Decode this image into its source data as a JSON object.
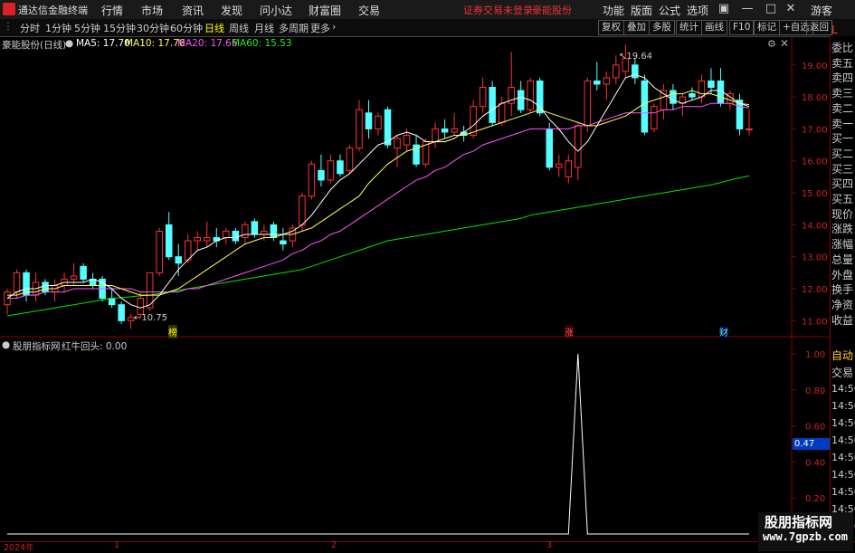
{
  "titlebar": {
    "app_title": "通达信金融终端",
    "menus": [
      "行情",
      "市场",
      "资讯",
      "发现",
      "问小达",
      "财富圈",
      "交易"
    ],
    "notice": "证券交易未登录",
    "stock_name": "豪能股份",
    "right_menus": [
      "功能",
      "版面",
      "公式",
      "选项"
    ],
    "guest": "游客"
  },
  "toolbar": {
    "periods": [
      "分时",
      "1分钟",
      "5分钟",
      "15分钟",
      "30分钟",
      "60分钟",
      "日线",
      "周线",
      "月线",
      "多周期",
      "更多"
    ],
    "active_period": "日线",
    "more_arrow": "›",
    "buttons": [
      "复权",
      "叠加",
      "多股",
      "统计",
      "画线",
      "F10",
      "标记",
      "+自选",
      "返回"
    ]
  },
  "main_chart": {
    "title": "豪能股份(日线)",
    "ma5_label": "MA5: 17.70",
    "ma10_label": "MA10: 17.76",
    "ma20_label": "MA20: 17.66",
    "ma60_label": "MA60: 15.53",
    "high_label": "19.64",
    "low_label": "10.75",
    "markers": [
      "榜",
      "涨",
      "财"
    ],
    "y_ticks": [
      "19.00",
      "18.00",
      "17.00",
      "16.00",
      "15.00",
      "14.00",
      "13.00",
      "12.00",
      "11.00"
    ]
  },
  "indicator": {
    "title": "股朋指标网",
    "series_label": "红牛回头: 0.00",
    "y_ticks": [
      "1.00",
      "0.80",
      "0.60",
      "0.40",
      "0.20"
    ],
    "cursor_value": "0.47"
  },
  "right_panel": {
    "labels": [
      "L",
      "委比",
      "卖五",
      "卖四",
      "卖三",
      "卖二",
      "卖一",
      "买一",
      "买二",
      "买三",
      "买四",
      "买五",
      "现价",
      "涨跌",
      "涨幅",
      "总量",
      "外盘",
      "换手",
      "净资",
      "收益"
    ],
    "trade_labels": [
      "自动",
      "交易"
    ],
    "times": [
      "14:56",
      "14:56",
      "14:56",
      "14:56",
      "14:56",
      "14:56",
      "14:56",
      "14:56",
      "14:56"
    ]
  },
  "x_axis": {
    "labels": [
      "2024年",
      "1",
      "2",
      "3"
    ]
  },
  "watermark": {
    "line1": "股朋指标网",
    "line2": "www.7gpzb.com"
  },
  "colors": {
    "up": "#ff3232",
    "down": "#54ffff",
    "ma5": "#ffffff",
    "ma10": "#ffff54",
    "ma20": "#ff54ff",
    "ma60": "#00e600",
    "frame": "#800000"
  },
  "chart_data": {
    "type": "candlestick",
    "ylim": [
      10.5,
      19.9
    ],
    "candles": [
      {
        "o": 11.5,
        "h": 12.0,
        "l": 11.2,
        "c": 11.9
      },
      {
        "o": 11.9,
        "h": 12.6,
        "l": 11.7,
        "c": 12.5
      },
      {
        "o": 12.5,
        "h": 12.6,
        "l": 11.6,
        "c": 11.8
      },
      {
        "o": 11.8,
        "h": 12.5,
        "l": 11.6,
        "c": 12.2
      },
      {
        "o": 12.2,
        "h": 12.3,
        "l": 11.8,
        "c": 11.9
      },
      {
        "o": 11.9,
        "h": 12.3,
        "l": 11.6,
        "c": 12.1
      },
      {
        "o": 12.1,
        "h": 12.5,
        "l": 11.9,
        "c": 12.3
      },
      {
        "o": 12.3,
        "h": 12.8,
        "l": 12.1,
        "c": 12.4
      },
      {
        "o": 12.7,
        "h": 12.8,
        "l": 12.2,
        "c": 12.3
      },
      {
        "o": 12.3,
        "h": 12.5,
        "l": 12.0,
        "c": 12.1
      },
      {
        "o": 12.3,
        "h": 12.4,
        "l": 11.6,
        "c": 11.7
      },
      {
        "o": 11.7,
        "h": 12.0,
        "l": 11.4,
        "c": 11.5
      },
      {
        "o": 11.5,
        "h": 11.6,
        "l": 10.9,
        "c": 11.0
      },
      {
        "o": 11.0,
        "h": 11.2,
        "l": 10.75,
        "c": 11.1
      },
      {
        "o": 11.2,
        "h": 11.9,
        "l": 11.1,
        "c": 11.7
      },
      {
        "o": 11.4,
        "h": 12.3,
        "l": 11.3,
        "c": 12.5
      },
      {
        "o": 12.5,
        "h": 13.9,
        "l": 12.4,
        "c": 13.8
      },
      {
        "o": 14.0,
        "h": 14.4,
        "l": 12.9,
        "c": 13.0
      },
      {
        "o": 13.0,
        "h": 13.4,
        "l": 12.4,
        "c": 12.8
      },
      {
        "o": 12.9,
        "h": 13.7,
        "l": 12.8,
        "c": 13.5
      },
      {
        "o": 13.5,
        "h": 13.8,
        "l": 13.2,
        "c": 13.6
      },
      {
        "o": 13.5,
        "h": 14.1,
        "l": 13.3,
        "c": 13.6
      },
      {
        "o": 13.6,
        "h": 13.9,
        "l": 13.3,
        "c": 13.5
      },
      {
        "o": 13.6,
        "h": 13.9,
        "l": 13.4,
        "c": 13.8
      },
      {
        "o": 13.8,
        "h": 13.9,
        "l": 13.4,
        "c": 13.5
      },
      {
        "o": 13.6,
        "h": 14.1,
        "l": 13.4,
        "c": 14.0
      },
      {
        "o": 14.1,
        "h": 14.2,
        "l": 13.6,
        "c": 13.7
      },
      {
        "o": 13.7,
        "h": 14.0,
        "l": 13.5,
        "c": 13.8
      },
      {
        "o": 14.0,
        "h": 14.1,
        "l": 13.5,
        "c": 13.6
      },
      {
        "o": 13.5,
        "h": 13.9,
        "l": 13.2,
        "c": 13.4
      },
      {
        "o": 13.5,
        "h": 14.0,
        "l": 13.3,
        "c": 13.9
      },
      {
        "o": 14.0,
        "h": 15.0,
        "l": 13.8,
        "c": 14.9
      },
      {
        "o": 14.9,
        "h": 16.0,
        "l": 14.8,
        "c": 15.9
      },
      {
        "o": 15.7,
        "h": 16.2,
        "l": 15.2,
        "c": 15.4
      },
      {
        "o": 15.4,
        "h": 16.2,
        "l": 15.3,
        "c": 16.0
      },
      {
        "o": 16.0,
        "h": 16.2,
        "l": 15.5,
        "c": 15.6
      },
      {
        "o": 15.7,
        "h": 16.5,
        "l": 15.6,
        "c": 16.4
      },
      {
        "o": 16.4,
        "h": 17.9,
        "l": 16.3,
        "c": 17.6
      },
      {
        "o": 17.5,
        "h": 17.9,
        "l": 16.7,
        "c": 17.0
      },
      {
        "o": 17.0,
        "h": 17.5,
        "l": 16.8,
        "c": 17.4
      },
      {
        "o": 17.6,
        "h": 17.7,
        "l": 16.4,
        "c": 16.5
      },
      {
        "o": 16.4,
        "h": 16.8,
        "l": 15.8,
        "c": 16.7
      },
      {
        "o": 16.5,
        "h": 17.0,
        "l": 16.3,
        "c": 16.8
      },
      {
        "o": 16.5,
        "h": 16.8,
        "l": 15.8,
        "c": 15.9
      },
      {
        "o": 15.9,
        "h": 16.7,
        "l": 15.8,
        "c": 16.6
      },
      {
        "o": 16.6,
        "h": 17.2,
        "l": 16.4,
        "c": 17.0
      },
      {
        "o": 17.0,
        "h": 17.3,
        "l": 16.7,
        "c": 16.9
      },
      {
        "o": 16.9,
        "h": 17.5,
        "l": 16.8,
        "c": 17.0
      },
      {
        "o": 16.9,
        "h": 17.1,
        "l": 16.6,
        "c": 16.8
      },
      {
        "o": 16.8,
        "h": 17.9,
        "l": 16.7,
        "c": 17.7
      },
      {
        "o": 17.7,
        "h": 18.6,
        "l": 17.5,
        "c": 18.3
      },
      {
        "o": 18.3,
        "h": 18.5,
        "l": 17.1,
        "c": 17.2
      },
      {
        "o": 17.2,
        "h": 18.0,
        "l": 17.1,
        "c": 17.8
      },
      {
        "o": 17.8,
        "h": 19.4,
        "l": 17.4,
        "c": 18.3
      },
      {
        "o": 18.2,
        "h": 18.5,
        "l": 17.5,
        "c": 17.6
      },
      {
        "o": 17.6,
        "h": 18.6,
        "l": 17.5,
        "c": 18.5
      },
      {
        "o": 18.5,
        "h": 18.6,
        "l": 17.4,
        "c": 17.5
      },
      {
        "o": 17.0,
        "h": 17.2,
        "l": 15.7,
        "c": 15.8
      },
      {
        "o": 15.8,
        "h": 16.2,
        "l": 15.5,
        "c": 15.9
      },
      {
        "o": 15.5,
        "h": 16.2,
        "l": 15.3,
        "c": 16.0
      },
      {
        "o": 15.8,
        "h": 17.2,
        "l": 15.4,
        "c": 17.1
      },
      {
        "o": 17.1,
        "h": 18.6,
        "l": 16.9,
        "c": 18.5
      },
      {
        "o": 18.5,
        "h": 19.1,
        "l": 18.2,
        "c": 18.4
      },
      {
        "o": 18.4,
        "h": 18.8,
        "l": 17.9,
        "c": 18.6
      },
      {
        "o": 18.6,
        "h": 19.3,
        "l": 18.4,
        "c": 19.0
      },
      {
        "o": 18.8,
        "h": 19.64,
        "l": 18.6,
        "c": 19.2
      },
      {
        "o": 19.0,
        "h": 19.2,
        "l": 18.4,
        "c": 18.6
      },
      {
        "o": 18.5,
        "h": 18.7,
        "l": 16.8,
        "c": 16.9
      },
      {
        "o": 17.0,
        "h": 17.8,
        "l": 16.9,
        "c": 17.7
      },
      {
        "o": 17.6,
        "h": 18.4,
        "l": 17.3,
        "c": 18.2
      },
      {
        "o": 18.2,
        "h": 18.4,
        "l": 17.6,
        "c": 17.8
      },
      {
        "o": 17.8,
        "h": 18.1,
        "l": 17.4,
        "c": 18.0
      },
      {
        "o": 18.1,
        "h": 18.3,
        "l": 17.9,
        "c": 18.0
      },
      {
        "o": 18.0,
        "h": 18.7,
        "l": 17.8,
        "c": 18.5
      },
      {
        "o": 18.5,
        "h": 18.9,
        "l": 18.1,
        "c": 18.3
      },
      {
        "o": 18.5,
        "h": 18.9,
        "l": 17.7,
        "c": 17.8
      },
      {
        "o": 17.8,
        "h": 18.2,
        "l": 17.6,
        "c": 18.1
      },
      {
        "o": 17.9,
        "h": 18.1,
        "l": 16.8,
        "c": 17.0
      },
      {
        "o": 17.0,
        "h": 17.6,
        "l": 16.8,
        "c": 17.0
      }
    ],
    "ma5": [
      11.7,
      11.9,
      12.0,
      12.0,
      12.1,
      12.1,
      12.2,
      12.2,
      12.2,
      12.3,
      12.2,
      12.0,
      11.7,
      11.5,
      11.4,
      11.5,
      11.8,
      12.2,
      12.6,
      12.9,
      13.2,
      13.3,
      13.5,
      13.6,
      13.6,
      13.7,
      13.7,
      13.7,
      13.7,
      13.7,
      13.8,
      14.0,
      14.3,
      14.7,
      15.1,
      15.4,
      15.6,
      15.9,
      16.2,
      16.5,
      16.6,
      16.8,
      16.9,
      16.8,
      16.6,
      16.6,
      16.6,
      16.7,
      16.9,
      17.1,
      17.4,
      17.6,
      17.8,
      17.9,
      18.0,
      17.9,
      17.7,
      17.3,
      17.0,
      16.6,
      16.3,
      16.6,
      17.1,
      17.6,
      18.1,
      18.6,
      18.7,
      18.6,
      18.3,
      18.1,
      17.9,
      17.8,
      17.9,
      18.0,
      18.2,
      18.2,
      18.0,
      17.8,
      17.7
    ],
    "ma10": [
      11.8,
      11.8,
      11.9,
      11.9,
      12.0,
      12.0,
      12.1,
      12.1,
      12.1,
      12.1,
      12.1,
      12.1,
      12.0,
      11.9,
      11.8,
      11.8,
      11.8,
      11.9,
      12.0,
      12.2,
      12.4,
      12.6,
      12.8,
      13.0,
      13.2,
      13.4,
      13.5,
      13.6,
      13.6,
      13.7,
      13.7,
      13.8,
      13.9,
      14.1,
      14.3,
      14.5,
      14.7,
      14.9,
      15.3,
      15.6,
      15.9,
      16.1,
      16.3,
      16.4,
      16.5,
      16.6,
      16.7,
      16.8,
      16.8,
      16.9,
      17.0,
      17.1,
      17.2,
      17.3,
      17.4,
      17.5,
      17.6,
      17.5,
      17.4,
      17.3,
      17.2,
      17.1,
      17.1,
      17.2,
      17.3,
      17.4,
      17.6,
      17.8,
      17.9,
      18.0,
      18.1,
      18.1,
      18.2,
      18.1,
      18.1,
      18.0,
      17.9,
      17.8,
      17.76
    ],
    "ma20": [
      11.7,
      11.7,
      11.8,
      11.8,
      11.9,
      11.9,
      11.9,
      12.0,
      12.0,
      12.0,
      12.0,
      12.0,
      12.0,
      12.0,
      11.9,
      11.9,
      11.9,
      11.9,
      11.9,
      12.0,
      12.0,
      12.1,
      12.2,
      12.3,
      12.4,
      12.5,
      12.6,
      12.7,
      12.8,
      12.9,
      13.1,
      13.2,
      13.4,
      13.5,
      13.7,
      13.8,
      14.0,
      14.2,
      14.4,
      14.6,
      14.8,
      15.0,
      15.2,
      15.4,
      15.5,
      15.7,
      15.8,
      16.0,
      16.2,
      16.3,
      16.5,
      16.6,
      16.7,
      16.8,
      16.9,
      17.0,
      17.0,
      17.0,
      17.0,
      17.0,
      17.1,
      17.1,
      17.2,
      17.3,
      17.4,
      17.5,
      17.5,
      17.5,
      17.5,
      17.6,
      17.6,
      17.7,
      17.7,
      17.7,
      17.8,
      17.8,
      17.8,
      17.7,
      17.66
    ],
    "ma60": [
      11.15,
      11.2,
      11.25,
      11.3,
      11.35,
      11.4,
      11.45,
      11.5,
      11.55,
      11.6,
      11.65,
      11.7,
      11.72,
      11.75,
      11.78,
      11.8,
      11.85,
      11.9,
      11.95,
      12.0,
      12.05,
      12.1,
      12.15,
      12.2,
      12.25,
      12.3,
      12.35,
      12.4,
      12.45,
      12.5,
      12.55,
      12.6,
      12.7,
      12.8,
      12.9,
      13.0,
      13.1,
      13.2,
      13.3,
      13.4,
      13.5,
      13.55,
      13.6,
      13.65,
      13.7,
      13.75,
      13.8,
      13.85,
      13.9,
      13.95,
      14.0,
      14.05,
      14.1,
      14.15,
      14.2,
      14.3,
      14.35,
      14.4,
      14.45,
      14.5,
      14.55,
      14.6,
      14.65,
      14.7,
      14.75,
      14.8,
      14.85,
      14.9,
      14.95,
      15.0,
      15.05,
      15.1,
      15.15,
      15.2,
      15.25,
      15.32,
      15.4,
      15.47,
      15.53
    ],
    "indicator_values_nonzero": {
      "index": 60,
      "value": 1.0
    },
    "indicator_ylim": [
      0,
      1.05
    ]
  }
}
